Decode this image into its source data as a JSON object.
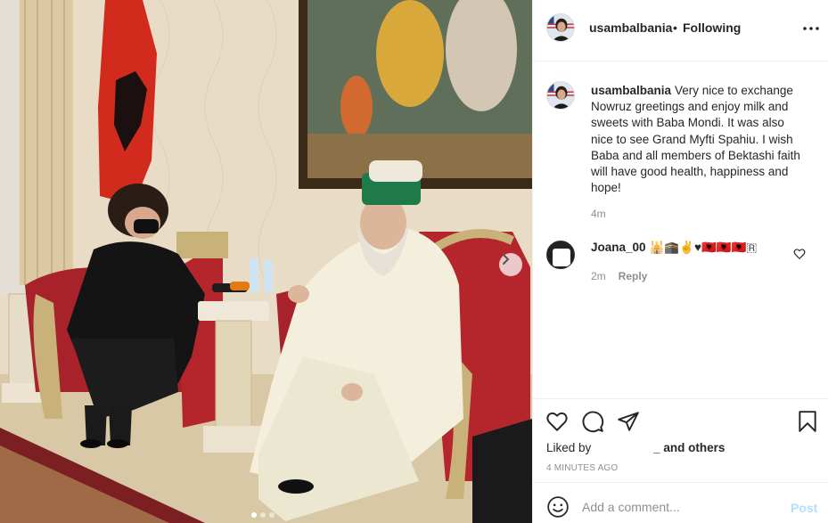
{
  "post": {
    "author": "usambalbania",
    "follow_separator": "•",
    "follow_label": "Following",
    "more_icon": "more-horizontal-icon",
    "caption_text": "Very nice to exchange Nowruz greetings and enjoy milk and sweets with Baba Mondi. It was also nice to see Grand Myfti Spahiu. I wish Baba and all members of Bektashi faith will have good health, happiness and hope!",
    "caption_time": "4m"
  },
  "comment": {
    "author": "Joana_00",
    "text": "🕌🕋✌️♥🇦🇱🇦🇱🇦🇱🇷",
    "time": "2m",
    "reply_label": "Reply"
  },
  "actions": {
    "like_icon": "heart-icon",
    "comment_icon": "comment-icon",
    "share_icon": "send-icon",
    "save_icon": "bookmark-icon",
    "liked_by_prefix": "Liked by",
    "liked_by_suffix": "_",
    "and_others": "and others",
    "time_ago": "4 MINUTES AGO"
  },
  "add_comment": {
    "placeholder": "Add a comment...",
    "post_label": "Post",
    "emoji_icon": "smiley-icon"
  },
  "carousel": {
    "current": 1,
    "total": 3
  },
  "colors": {
    "text_primary": "#262626",
    "text_secondary": "#8e8e8e",
    "post_button_disabled": "#b2dffc",
    "border": "#efefef",
    "flag_red": "#d32a1e",
    "robe_cream": "#f3efdc",
    "hat_green": "#1f7a4a"
  }
}
